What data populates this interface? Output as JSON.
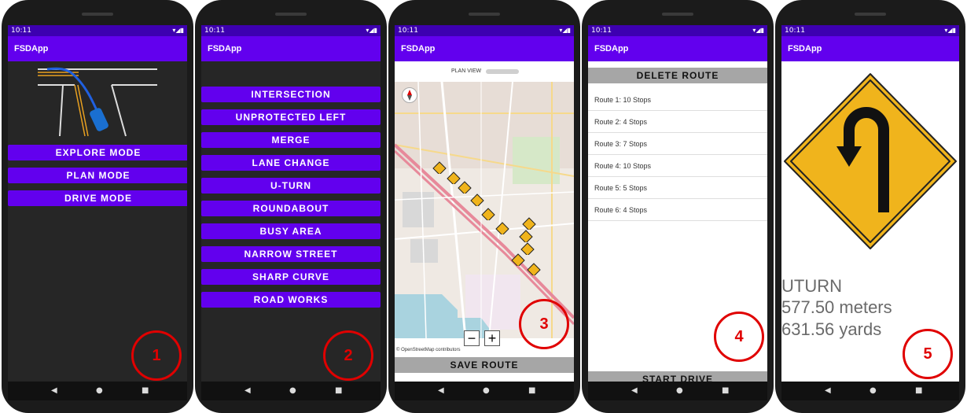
{
  "colors": {
    "accent": "#6200ee",
    "status_bar": "#3d00b0",
    "marker": "#e00000",
    "grey_button": "#a6a6a6",
    "sign_yellow": "#f0b41c"
  },
  "status": {
    "time": "10:11",
    "icons": "▾◢▮",
    "nav_back": "◀",
    "nav_home": "●",
    "nav_recent": "■"
  },
  "screen1": {
    "app_title": "FSDApp",
    "buttons": [
      "EXPLORE MODE",
      "PLAN MODE",
      "DRIVE MODE"
    ],
    "marker": "1"
  },
  "screen2": {
    "app_title": "FSDApp",
    "scenarios": [
      "INTERSECTION",
      "UNPROTECTED LEFT",
      "MERGE",
      "LANE CHANGE",
      "U-TURN",
      "ROUNDABOUT",
      "BUSY AREA",
      "NARROW STREET",
      "SHARP CURVE",
      "ROAD WORKS"
    ],
    "marker": "2"
  },
  "screen3": {
    "app_title": "FSDApp",
    "map_title": "PLAN VIEW",
    "zoom_out": "−",
    "zoom_in": "+",
    "attribution": "© OpenStreetMap contributors",
    "save_label": "SAVE ROUTE",
    "marker": "3"
  },
  "screen4": {
    "app_title": "FSDApp",
    "delete_label": "DELETE ROUTE",
    "routes": [
      "Route 1: 10 Stops",
      "Route 2: 4 Stops",
      "Route 3: 7 Stops",
      "Route 4: 10 Stops",
      "Route 5: 5 Stops",
      "Route 6: 4 Stops"
    ],
    "start_label": "START DRIVE",
    "marker": "4"
  },
  "screen5": {
    "app_title": "FSDApp",
    "maneuver": "UTURN",
    "meters": "577.50 meters",
    "yards": "631.56 yards",
    "marker": "5"
  }
}
